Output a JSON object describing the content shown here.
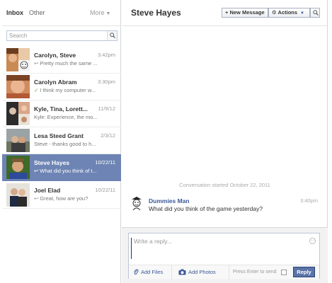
{
  "sidebar": {
    "tabs": {
      "inbox": "Inbox",
      "other": "Other",
      "more": "More"
    },
    "search_placeholder": "Search",
    "threads": [
      {
        "name": "Carolyn, Steve",
        "date": "3:42pm",
        "snippet": "Pretty much the same ...",
        "icon": "reply-icon"
      },
      {
        "name": "Carolyn Abram",
        "date": "3:30pm",
        "snippet": "I think my computer w...",
        "icon": "check-icon"
      },
      {
        "name": "Kyle, Tina, Lorett...",
        "date": "11/9/12",
        "snippet": "Kyle: Experience, the mo..."
      },
      {
        "name": "Lesa Steed Grant",
        "date": "2/3/12",
        "snippet": "Steve - thanks good to h..."
      },
      {
        "name": "Steve Hayes",
        "date": "10/22/11",
        "snippet": "What did you think of t...",
        "icon": "reply-icon",
        "selected": true
      },
      {
        "name": "Joel Elad",
        "date": "10/22/11",
        "snippet": "Great, how are you?",
        "icon": "reply-icon"
      }
    ]
  },
  "conversation": {
    "title": "Steve Hayes",
    "toolbar": {
      "new_message": "+ New Message",
      "actions": "Actions"
    },
    "started": "Conversation started October 22, 2011",
    "messages": [
      {
        "author": "Dummies Man",
        "time": "3:40pm",
        "text": "What did you think of the game yesterday?"
      }
    ]
  },
  "composer": {
    "placeholder": "Write a reply...",
    "add_files": "Add Files",
    "add_photos": "Add Photos",
    "press_enter": "Press Enter to send",
    "reply": "Reply"
  },
  "colors": {
    "selected_row": "#6d84b4",
    "link": "#3b5998",
    "reply_button": "#5b74a8"
  }
}
